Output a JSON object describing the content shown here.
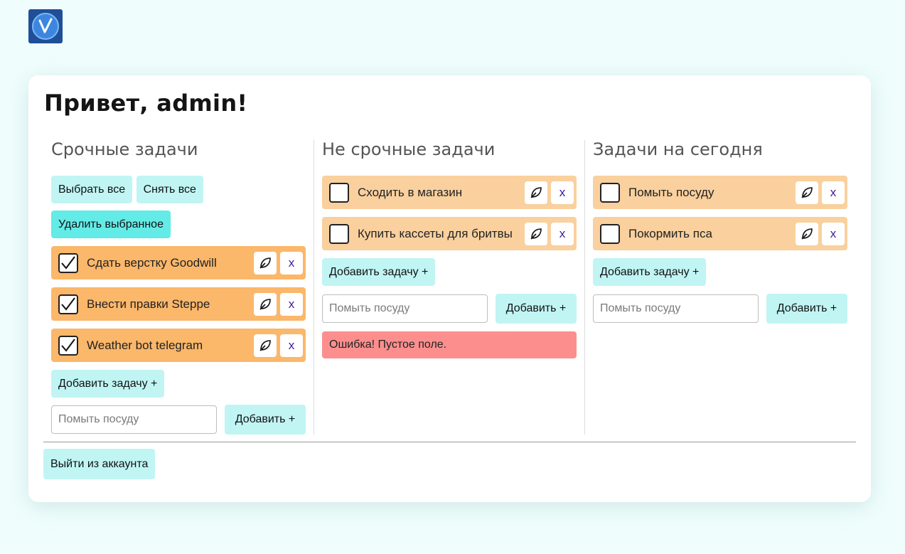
{
  "logo": {
    "letter": "V"
  },
  "greeting": "Привет, admin!",
  "columns": [
    {
      "title": "Срочные задачи",
      "select_all_label": "Выбрать все",
      "deselect_all_label": "Снять все",
      "delete_selected_label": "Удалить выбранное",
      "tasks": [
        {
          "label": "Сдать верстку Goodwill",
          "checked": true
        },
        {
          "label": "Внести правки Steppe",
          "checked": true
        },
        {
          "label": "Weather bot telegram",
          "checked": true
        }
      ],
      "add_task_label": "Добавить задачу +",
      "input_placeholder": "Помыть посуду",
      "add_label": "Добавить +"
    },
    {
      "title": "Не срочные задачи",
      "tasks": [
        {
          "label": "Сходить в магазин",
          "checked": false
        },
        {
          "label": "Купить кассеты для бритвы",
          "checked": false
        }
      ],
      "add_task_label": "Добавить задачу +",
      "input_placeholder": "Помыть посуду",
      "add_label": "Добавить +",
      "error_text": "Ошибка! Пустое поле."
    },
    {
      "title": "Задачи на сегодня",
      "tasks": [
        {
          "label": "Помыть посуду",
          "checked": false
        },
        {
          "label": "Покормить пса",
          "checked": false
        }
      ],
      "add_task_label": "Добавить задачу +",
      "input_placeholder": "Помыть посуду",
      "add_label": "Добавить +"
    }
  ],
  "edit_icon": "feather-icon",
  "delete_icon": "x",
  "logout_label": "Выйти из аккаунта",
  "colors": {
    "page_bg": "#effefd",
    "urgent_task_bg": "#fbb76a",
    "normal_task_bg": "#f9d09e",
    "button_bg": "#c0f5f4",
    "delete_selected_bg": "#63ebe7",
    "error_bg": "#fc8f8d"
  }
}
